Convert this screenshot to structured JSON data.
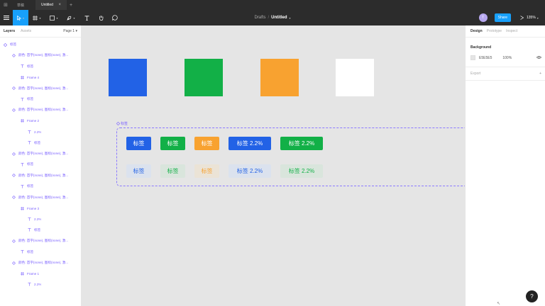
{
  "titlebar": {
    "tabs": [
      {
        "label": "草稿"
      },
      {
        "label": "Untitled",
        "active": true
      }
    ],
    "plus": "+"
  },
  "toolbar": {
    "breadcrumb_root": "Drafts",
    "separator": "/",
    "file_name": "Untitled",
    "avatar_initial": "T",
    "share_label": "Share",
    "zoom": "135%"
  },
  "left_panel": {
    "tabs": [
      "Layers",
      "Assets"
    ],
    "page": "Page 1",
    "layers": [
      {
        "label": "标签",
        "indent": 0,
        "icon": "component"
      },
      {
        "label": "颜色: 首字(none), 图标(none), 激...",
        "indent": 1,
        "icon": "instance"
      },
      {
        "label": "标签",
        "indent": 2,
        "icon": "text"
      },
      {
        "label": "Frame 4",
        "indent": 2,
        "icon": "frame"
      },
      {
        "label": "颜色: 首字(none), 图标(none), 激...",
        "indent": 1,
        "icon": "instance"
      },
      {
        "label": "标签",
        "indent": 2,
        "icon": "text"
      },
      {
        "label": "颜色: 首字(none), 图标(none), 激...",
        "indent": 1,
        "icon": "instance"
      },
      {
        "label": "Frame 2",
        "indent": 2,
        "icon": "frame"
      },
      {
        "label": "2.2%",
        "indent": 3,
        "icon": "text"
      },
      {
        "label": "标签",
        "indent": 3,
        "icon": "text"
      },
      {
        "label": "颜色: 首字(none), 图标(none), 激...",
        "indent": 1,
        "icon": "instance"
      },
      {
        "label": "标签",
        "indent": 2,
        "icon": "text"
      },
      {
        "label": "颜色: 首字(none), 图标(none), 激...",
        "indent": 1,
        "icon": "instance"
      },
      {
        "label": "标签",
        "indent": 2,
        "icon": "text"
      },
      {
        "label": "颜色: 首字(none), 图标(none), 激...",
        "indent": 1,
        "icon": "instance"
      },
      {
        "label": "Frame 3",
        "indent": 2,
        "icon": "frame"
      },
      {
        "label": "2.2%",
        "indent": 3,
        "icon": "text"
      },
      {
        "label": "标签",
        "indent": 3,
        "icon": "text"
      },
      {
        "label": "颜色: 首字(none), 图标(none), 激...",
        "indent": 1,
        "icon": "instance"
      },
      {
        "label": "标签",
        "indent": 2,
        "icon": "text"
      },
      {
        "label": "颜色: 首字(none), 图标(none), 激...",
        "indent": 1,
        "icon": "instance"
      },
      {
        "label": "Frame 1",
        "indent": 2,
        "icon": "frame"
      },
      {
        "label": "2.2%",
        "indent": 3,
        "icon": "text"
      }
    ]
  },
  "canvas": {
    "swatches": [
      {
        "color": "#2262e6"
      },
      {
        "color": "#12b047"
      },
      {
        "color": "#f8a230"
      },
      {
        "color": "#ffffff"
      }
    ],
    "frame_label": "标签",
    "solid_tags": [
      {
        "label": "标签",
        "bg": "#2262e6",
        "fg": "#ffffff"
      },
      {
        "label": "标签",
        "bg": "#12b047",
        "fg": "#ffffff"
      },
      {
        "label": "标签",
        "bg": "#f8a230",
        "fg": "#ffffff"
      },
      {
        "label": "标签 2.2%",
        "bg": "#2262e6",
        "fg": "#ffffff"
      },
      {
        "label": "标签 2.2%",
        "bg": "#12b047",
        "fg": "#ffffff"
      }
    ],
    "light_tags": [
      {
        "label": "标签",
        "bg": "#dbe2ee",
        "fg": "#2262e6"
      },
      {
        "label": "标签",
        "bg": "#d9e5dc",
        "fg": "#12b047"
      },
      {
        "label": "标签",
        "bg": "#ebe3d6",
        "fg": "#f8a230"
      },
      {
        "label": "标签 2.2%",
        "bg": "#dbe2ee",
        "fg": "#2262e6"
      },
      {
        "label": "标签 2.2%",
        "bg": "#d9e5dc",
        "fg": "#12b047"
      }
    ]
  },
  "right_panel": {
    "tabs": [
      {
        "label": "Design",
        "active": true
      },
      {
        "label": "Prototype",
        "active": false
      },
      {
        "label": "Inspect",
        "active": false
      }
    ],
    "background_title": "Background",
    "background_hex": "E5E5E5",
    "background_opacity": "100%",
    "export_title": "Export",
    "export_plus": "+"
  },
  "help_label": "?"
}
